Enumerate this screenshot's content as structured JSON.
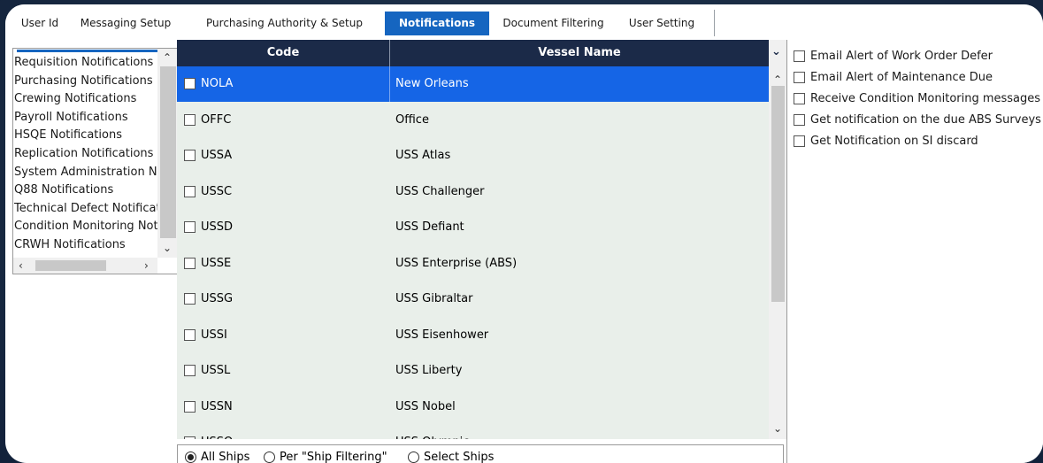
{
  "tabs": [
    {
      "label": "User Id",
      "active": false
    },
    {
      "label": "Messaging Setup",
      "active": false
    },
    {
      "label": "Purchasing Authority & Setup",
      "active": false
    },
    {
      "label": "Notifications",
      "active": true
    },
    {
      "label": "Document Filtering",
      "active": false
    },
    {
      "label": "User Setting",
      "active": false
    }
  ],
  "notification_categories": [
    "Requisition Notifications",
    "Purchasing Notifications",
    "Crewing Notifications",
    "Payroll Notifications",
    "HSQE Notifications",
    "Replication Notifications",
    "System Administration Notifications",
    "Q88 Notifications",
    "Technical Defect Notifications",
    "Condition Monitoring Notifications",
    "CRWH Notifications"
  ],
  "grid": {
    "columns": [
      "Code",
      "Vessel Name"
    ],
    "rows": [
      {
        "code": "NOLA",
        "name": "New Orleans",
        "selected": true
      },
      {
        "code": "OFFC",
        "name": "Office",
        "selected": false
      },
      {
        "code": "USSA",
        "name": "USS Atlas",
        "selected": false
      },
      {
        "code": "USSC",
        "name": "USS Challenger",
        "selected": false
      },
      {
        "code": "USSD",
        "name": "USS Defiant",
        "selected": false
      },
      {
        "code": "USSE",
        "name": "USS Enterprise (ABS)",
        "selected": false
      },
      {
        "code": "USSG",
        "name": "USS Gibraltar",
        "selected": false
      },
      {
        "code": "USSI",
        "name": "USS Eisenhower",
        "selected": false
      },
      {
        "code": "USSL",
        "name": "USS Liberty",
        "selected": false
      },
      {
        "code": "USSN",
        "name": "USS Nobel",
        "selected": false
      },
      {
        "code": "USSO",
        "name": "USS Olympic",
        "selected": false
      }
    ]
  },
  "ship_filter": {
    "options": [
      "All Ships",
      "Per \"Ship Filtering\"",
      "Select Ships"
    ],
    "selected": "All Ships"
  },
  "alert_options": [
    "Email Alert of Work Order Defer",
    "Email Alert of Maintenance Due",
    "Receive Condition Monitoring messages",
    "Get notification on the due ABS Surveys",
    "Get Notification on SI discard"
  ],
  "colors": {
    "accent": "#1565c0",
    "header_bg": "#1b2a48",
    "selected_row": "#1565e6",
    "grid_bg": "#e9efea"
  }
}
